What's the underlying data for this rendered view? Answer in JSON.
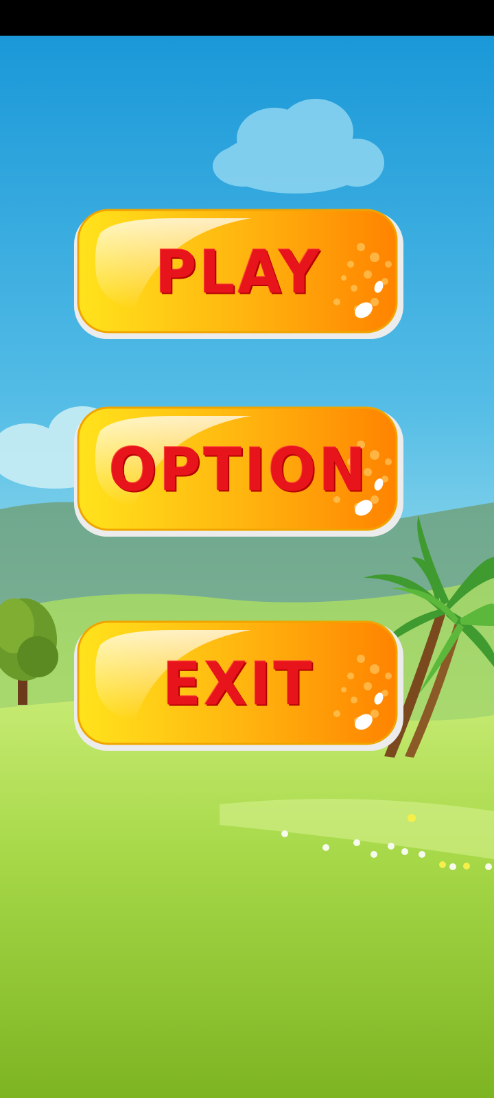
{
  "menu": {
    "play_label": "PLAY",
    "option_label": "OPTION",
    "exit_label": "EXIT"
  },
  "colors": {
    "sky_top": "#1b9ad9",
    "sky_bottom": "#bfeef0",
    "grass_light": "#b8e35a",
    "grass_dark": "#7fb623",
    "button_yellow": "#ffd21a",
    "button_orange": "#ff8a00",
    "label_red": "#e8141b"
  },
  "icons": [
    "cloud-icon",
    "palm-tree-icon",
    "tree-icon",
    "hill-icon"
  ]
}
